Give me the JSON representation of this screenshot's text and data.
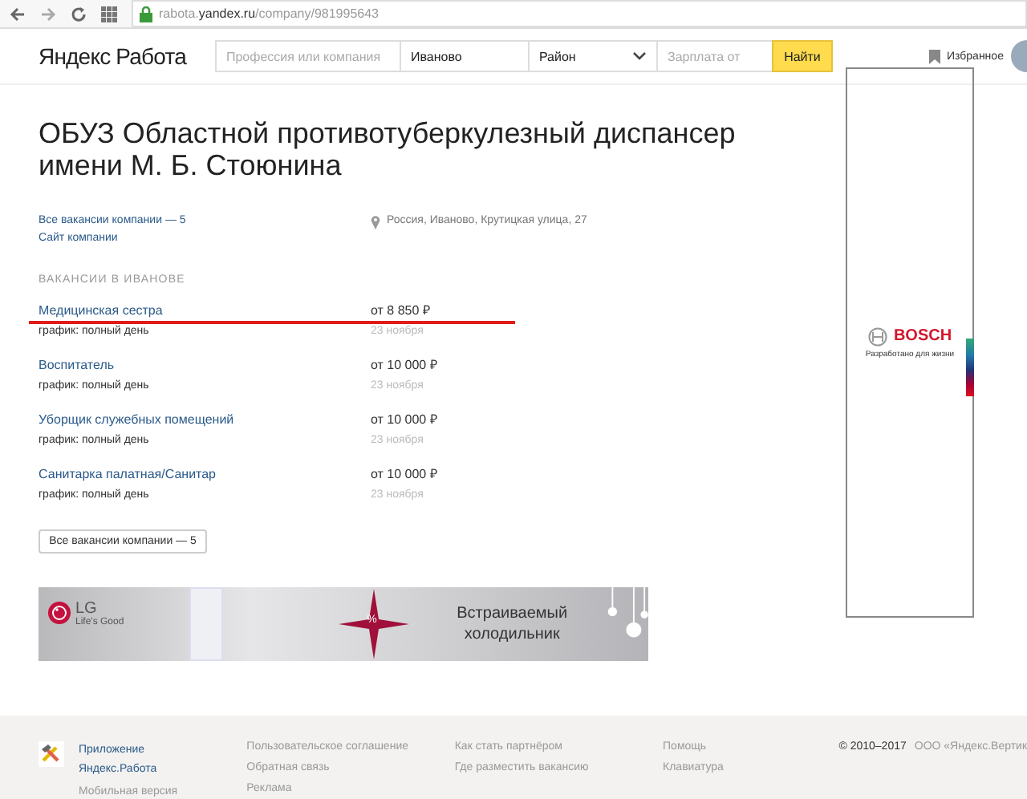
{
  "browser": {
    "url_host": "rabota.",
    "url_domain": "yandex.ru",
    "url_path": "/company/981995643"
  },
  "header": {
    "logo_brand": "Яндекс",
    "logo_product": "Работа",
    "profession_placeholder": "Профессия или компания",
    "city": "Иваново",
    "district": "Район",
    "salary_placeholder": "Зарплата от",
    "search_button": "Найти",
    "favorites": "Избранное"
  },
  "company": {
    "title": "ОБУЗ Областной противотуберкулезный диспансер имени М. Б. Стоюнина",
    "all_vacancies_link": "Все вакансии компании — 5",
    "site_link": "Сайт компании",
    "address": "Россия, Иваново, Крутицкая улица, 27"
  },
  "section_title": "ВАКАНСИИ В ИВАНОВЕ",
  "vacancies": [
    {
      "title": "Медицинская сестра",
      "schedule": "график: полный день",
      "salary": "от 8 850 ₽",
      "date": "23 ноября",
      "underlined": true
    },
    {
      "title": "Воспитатель",
      "schedule": "график: полный день",
      "salary": "от 10 000 ₽",
      "date": "23 ноября",
      "underlined": false
    },
    {
      "title": "Уборщик служебных помещений",
      "schedule": "график: полный день",
      "salary": "от 10 000 ₽",
      "date": "23 ноября",
      "underlined": false
    },
    {
      "title": "Санитарка палатная/Санитар",
      "schedule": "график: полный день",
      "salary": "от 10 000 ₽",
      "date": "23 ноября",
      "underlined": false
    }
  ],
  "all_vacancies_button": "Все вакансии компании — 5",
  "banner": {
    "brand": "LG",
    "tagline": "Life's Good",
    "badge": "%",
    "text": "Встраиваемый холодильник"
  },
  "side_ad": {
    "brand": "BOSCH",
    "tagline": "Разработано для жизни"
  },
  "footer": {
    "app_link": "Приложение Яндекс.Работа",
    "columns": [
      [
        "Мобильная версия"
      ],
      [
        "Пользовательское соглашение",
        "Обратная связь",
        "Реклама"
      ],
      [
        "Как стать партнёром",
        "Где разместить вакансию"
      ],
      [
        "Помощь",
        "Клавиатура"
      ]
    ],
    "copyright": "© 2010–2017",
    "company": "ООО «Яндекс.Вертик"
  }
}
